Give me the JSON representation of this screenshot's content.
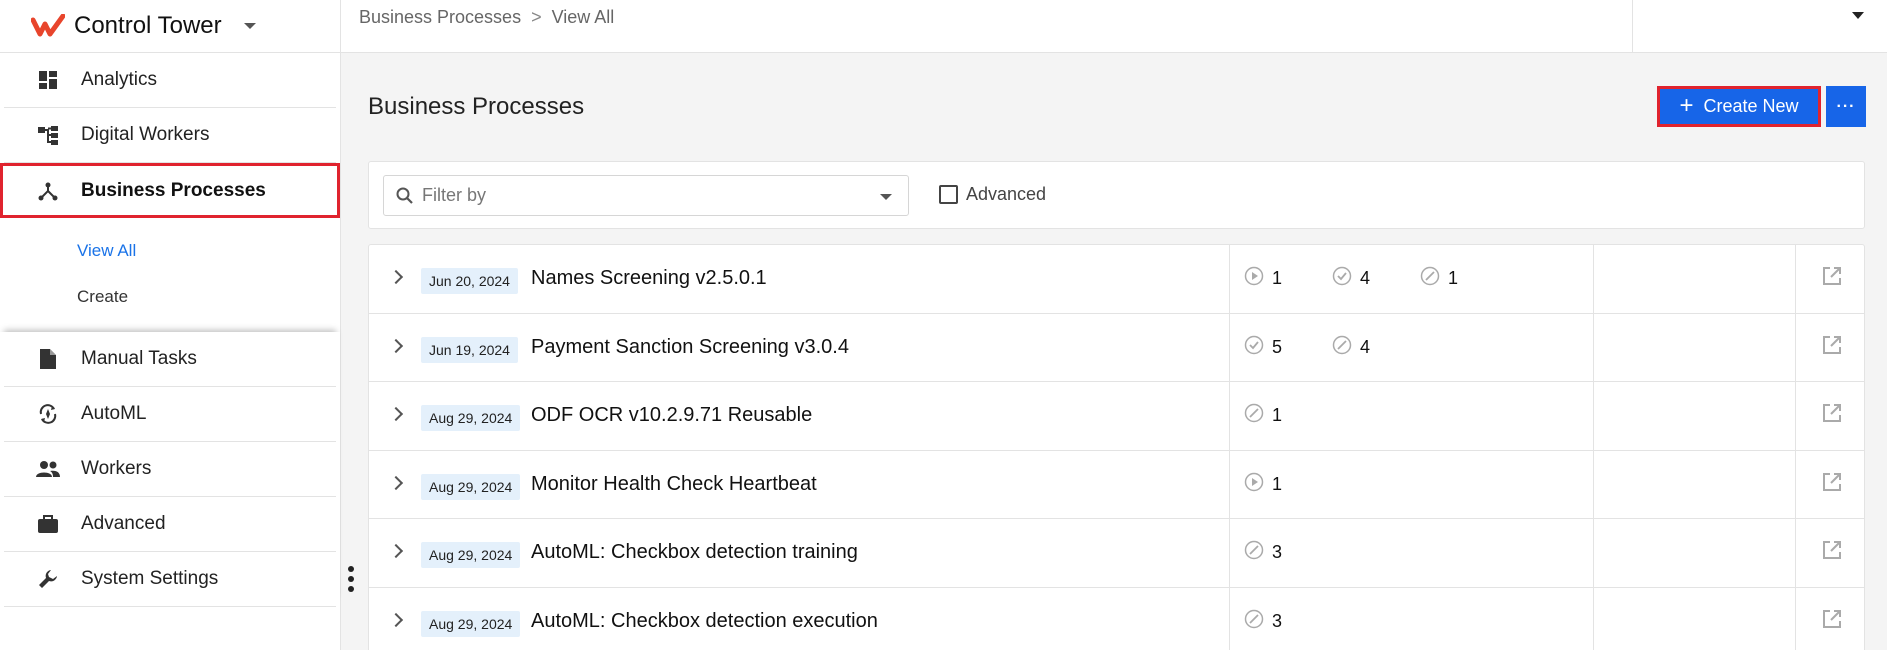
{
  "app": {
    "title": "Control Tower"
  },
  "sidebar": {
    "items": [
      {
        "label": "Analytics",
        "icon": "dashboard-icon"
      },
      {
        "label": "Digital Workers",
        "icon": "org-tree-icon"
      },
      {
        "label": "Business Processes",
        "icon": "process-fork-icon",
        "active": true
      },
      {
        "label": "Manual Tasks",
        "icon": "document-icon"
      },
      {
        "label": "AutoML",
        "icon": "automl-icon"
      },
      {
        "label": "Workers",
        "icon": "people-icon"
      },
      {
        "label": "Advanced",
        "icon": "briefcase-icon"
      },
      {
        "label": "System Settings",
        "icon": "wrench-icon"
      }
    ],
    "sub_items": [
      {
        "label": "View All",
        "current": true
      },
      {
        "label": "Create"
      }
    ]
  },
  "breadcrumb": {
    "items": [
      "Business Processes",
      "View All"
    ],
    "separator": ">"
  },
  "main": {
    "title": "Business Processes",
    "create_label": "Create New",
    "more_label": "···"
  },
  "filter": {
    "placeholder": "Filter by",
    "advanced_label": "Advanced"
  },
  "rows": [
    {
      "date": "Jun 20, 2024",
      "name": "Names Screening v2.5.0.1",
      "stats": [
        {
          "type": "running",
          "value": "1"
        },
        {
          "type": "completed",
          "value": "4"
        },
        {
          "type": "disabled",
          "value": "1"
        }
      ]
    },
    {
      "date": "Jun 19, 2024",
      "name": "Payment Sanction Screening v3.0.4",
      "stats": [
        {
          "type": "completed",
          "value": "5"
        },
        {
          "type": "disabled",
          "value": "4"
        }
      ]
    },
    {
      "date": "Aug 29, 2024",
      "name": "ODF OCR v10.2.9.71 Reusable",
      "stats": [
        {
          "type": "disabled",
          "value": "1"
        }
      ]
    },
    {
      "date": "Aug 29, 2024",
      "name": "Monitor Health Check Heartbeat",
      "stats": [
        {
          "type": "running",
          "value": "1"
        }
      ]
    },
    {
      "date": "Aug 29, 2024",
      "name": "AutoML: Checkbox detection training",
      "stats": [
        {
          "type": "disabled",
          "value": "3"
        }
      ]
    },
    {
      "date": "Aug 29, 2024",
      "name": "AutoML: Checkbox detection execution",
      "stats": [
        {
          "type": "disabled",
          "value": "3"
        }
      ]
    }
  ],
  "colors": {
    "accent": "#1765e8",
    "highlight": "#e0232e",
    "link": "#1a73e8",
    "date_badge": "#e4f0fb",
    "brand": "#e8452c"
  }
}
